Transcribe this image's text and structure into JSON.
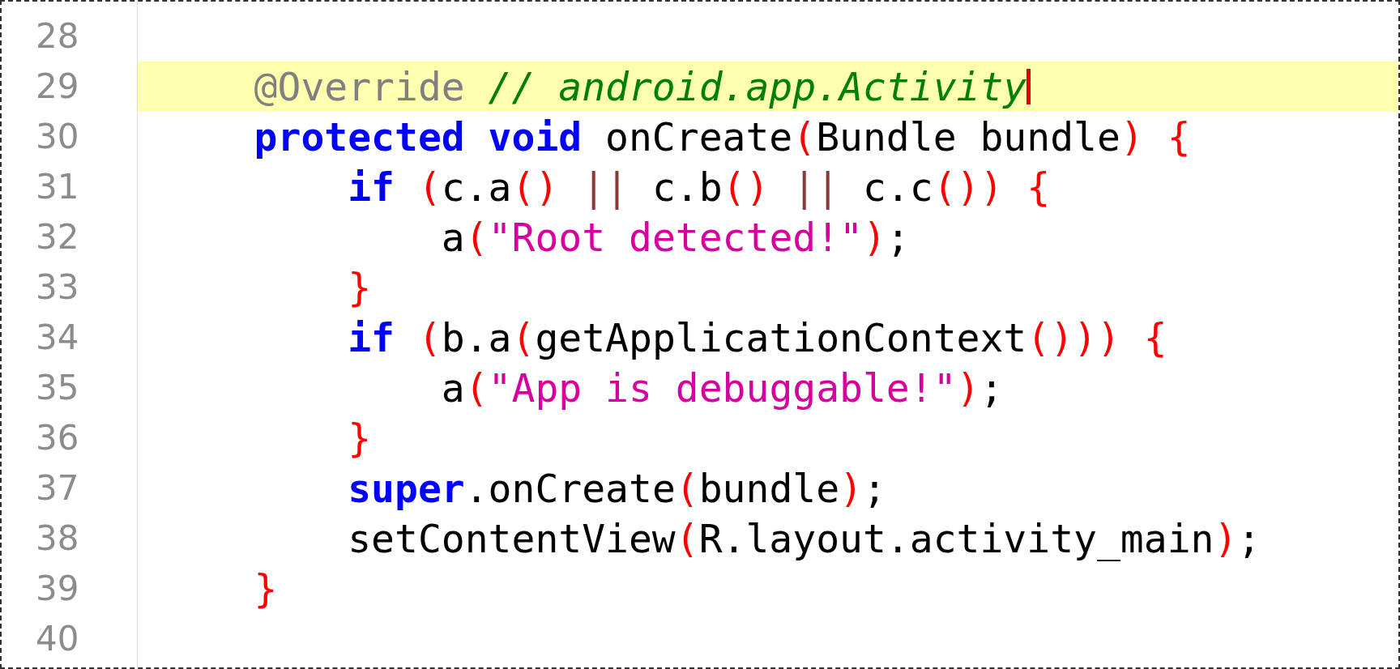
{
  "editor": {
    "lines": [
      {
        "number": "28",
        "highlighted": false,
        "cursor": false
      },
      {
        "number": "29",
        "highlighted": true,
        "cursor": true,
        "tokens": [
          {
            "kind": "annotation",
            "text": "    @Override "
          },
          {
            "kind": "comment",
            "text": "// android.app.Activity"
          }
        ]
      },
      {
        "number": "30",
        "highlighted": false,
        "cursor": false,
        "tokens": [
          {
            "kind": "keyword",
            "text": "    protected void"
          },
          {
            "kind": "plain",
            "text": " onCreate"
          },
          {
            "kind": "brace",
            "text": "("
          },
          {
            "kind": "plain",
            "text": "Bundle bundle"
          },
          {
            "kind": "brace",
            "text": ") {"
          }
        ]
      },
      {
        "number": "31",
        "highlighted": false,
        "cursor": false,
        "tokens": [
          {
            "kind": "keyword",
            "text": "        if"
          },
          {
            "kind": "brace",
            "text": " ("
          },
          {
            "kind": "plain",
            "text": "c.a"
          },
          {
            "kind": "brace",
            "text": "()"
          },
          {
            "kind": "operator",
            "text": " ||"
          },
          {
            "kind": "plain",
            "text": " c.b"
          },
          {
            "kind": "brace",
            "text": "()"
          },
          {
            "kind": "operator",
            "text": " ||"
          },
          {
            "kind": "plain",
            "text": " c.c"
          },
          {
            "kind": "brace",
            "text": "()) {"
          }
        ]
      },
      {
        "number": "32",
        "highlighted": false,
        "cursor": false,
        "tokens": [
          {
            "kind": "plain",
            "text": "            a"
          },
          {
            "kind": "brace",
            "text": "("
          },
          {
            "kind": "string",
            "text": "\"Root detected!\""
          },
          {
            "kind": "brace",
            "text": ")"
          },
          {
            "kind": "plain",
            "text": ";"
          }
        ]
      },
      {
        "number": "33",
        "highlighted": false,
        "cursor": false,
        "tokens": [
          {
            "kind": "brace",
            "text": "        }"
          }
        ]
      },
      {
        "number": "34",
        "highlighted": false,
        "cursor": false,
        "tokens": [
          {
            "kind": "keyword",
            "text": "        if"
          },
          {
            "kind": "brace",
            "text": " ("
          },
          {
            "kind": "plain",
            "text": "b.a"
          },
          {
            "kind": "brace",
            "text": "("
          },
          {
            "kind": "plain",
            "text": "getApplicationContext"
          },
          {
            "kind": "brace",
            "text": "())) {"
          }
        ]
      },
      {
        "number": "35",
        "highlighted": false,
        "cursor": false,
        "tokens": [
          {
            "kind": "plain",
            "text": "            a"
          },
          {
            "kind": "brace",
            "text": "("
          },
          {
            "kind": "string",
            "text": "\"App is debuggable!\""
          },
          {
            "kind": "brace",
            "text": ")"
          },
          {
            "kind": "plain",
            "text": ";"
          }
        ]
      },
      {
        "number": "36",
        "highlighted": false,
        "cursor": false,
        "tokens": [
          {
            "kind": "brace",
            "text": "        }"
          }
        ]
      },
      {
        "number": "37",
        "highlighted": false,
        "cursor": false,
        "tokens": [
          {
            "kind": "keyword",
            "text": "        super"
          },
          {
            "kind": "plain",
            "text": ".onCreate"
          },
          {
            "kind": "brace",
            "text": "("
          },
          {
            "kind": "plain",
            "text": "bundle"
          },
          {
            "kind": "brace",
            "text": ")"
          },
          {
            "kind": "plain",
            "text": ";"
          }
        ]
      },
      {
        "number": "38",
        "highlighted": false,
        "cursor": false,
        "tokens": [
          {
            "kind": "plain",
            "text": "        setContentView"
          },
          {
            "kind": "brace",
            "text": "("
          },
          {
            "kind": "plain",
            "text": "R.layout.activity_main"
          },
          {
            "kind": "brace",
            "text": ")"
          },
          {
            "kind": "plain",
            "text": ";"
          }
        ]
      },
      {
        "number": "39",
        "highlighted": false,
        "cursor": false,
        "tokens": [
          {
            "kind": "brace",
            "text": "    }"
          }
        ]
      },
      {
        "number": "40",
        "highlighted": false,
        "cursor": false
      }
    ]
  }
}
